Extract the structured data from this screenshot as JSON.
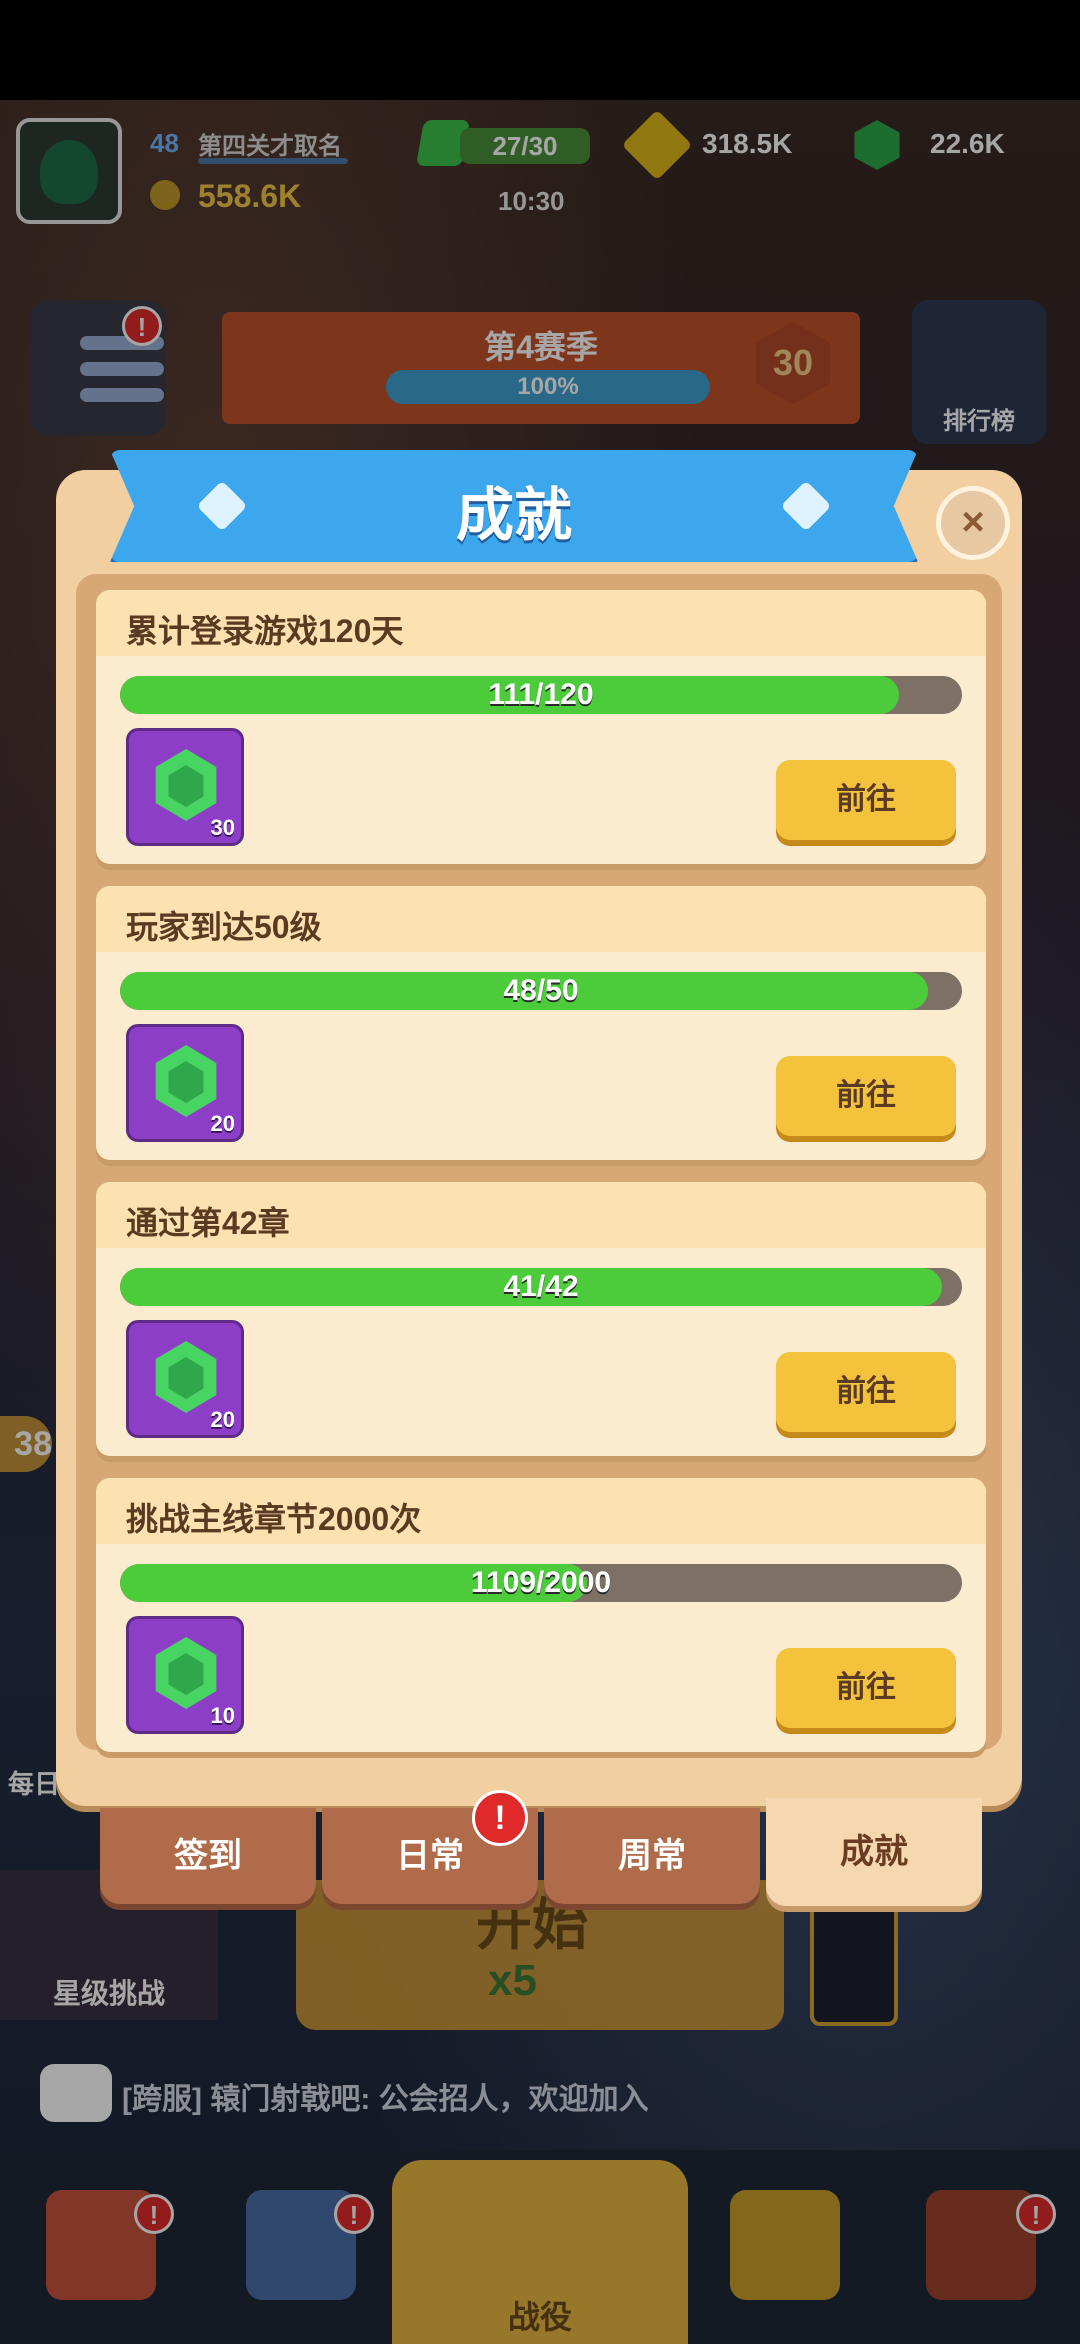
{
  "hud": {
    "level": "48",
    "player_name": "第四关才取名",
    "power": "558.6K",
    "energy": "27/30",
    "energy_timer": "10:30",
    "gold": "318.5K",
    "gems": "22.6K"
  },
  "season": {
    "title": "第4赛季",
    "progress": "100%",
    "badge_level": "30"
  },
  "ranking_label": "排行榜",
  "modal": {
    "title": "成就",
    "close_icon": "×",
    "cards": [
      {
        "title": "累计登录游戏120天",
        "progress_text": "111/120",
        "fraction": 0.925,
        "reward_amount": "30",
        "button": "前往"
      },
      {
        "title": "玩家到达50级",
        "progress_text": "48/50",
        "fraction": 0.96,
        "reward_amount": "20",
        "button": "前往"
      },
      {
        "title": "通过第42章",
        "progress_text": "41/42",
        "fraction": 0.976,
        "reward_amount": "20",
        "button": "前往"
      },
      {
        "title": "挑战主线章节2000次",
        "progress_text": "1109/2000",
        "fraction": 0.5545,
        "reward_amount": "10",
        "button": "前往"
      }
    ]
  },
  "tabs": [
    {
      "label": "签到"
    },
    {
      "label": "日常",
      "alert": "!"
    },
    {
      "label": "周常"
    },
    {
      "label": "成就",
      "active": true
    }
  ],
  "background": {
    "star_challenge": "星级挑战",
    "start_text": "开始",
    "start_cost": "x5",
    "left_edge_number": "38",
    "daily_label": "每日",
    "chat": "[跨服] 辕门射戟吧: 公会招人，欢迎加入",
    "nav_center": "战役"
  },
  "alert_mark": "!",
  "colors": {
    "accent_blue": "#3da7ee",
    "progress_green": "#4ccc3a",
    "button_yellow": "#f4c33b",
    "reward_purple": "#8c3ec6",
    "alert_red": "#e02a2a"
  }
}
